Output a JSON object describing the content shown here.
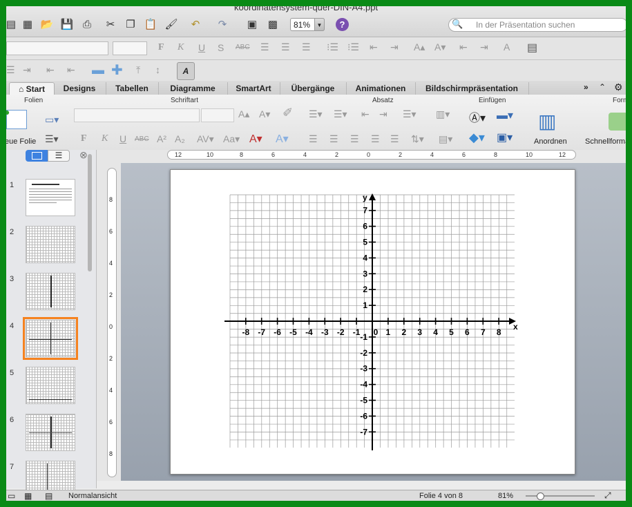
{
  "window": {
    "title": "koordinatensystem-quer-DIN-A4.ppt"
  },
  "toolbar": {
    "zoom": "81%",
    "help_label": "?",
    "search_placeholder": "In der Präsentation suchen",
    "font_size_button": "A",
    "icons": [
      "new-slide-icon",
      "gallery-icon",
      "open-icon",
      "save-icon",
      "print-icon",
      "cut-icon",
      "copy-icon",
      "paste-icon",
      "format-painter-icon",
      "undo-icon",
      "redo-icon",
      "slideshow-icon",
      "media-icon"
    ]
  },
  "format_bar": {
    "bold": "F",
    "italic": "K",
    "underline": "U",
    "shadow": "S",
    "strike": "ABC"
  },
  "tabs": [
    "Start",
    "Designs",
    "Tabellen",
    "Diagramme",
    "SmartArt",
    "Übergänge",
    "Animationen",
    "Bildschirmpräsentation"
  ],
  "ribbon": {
    "groups": [
      "Folien",
      "Schriftart",
      "Absatz",
      "Einfügen",
      "Form"
    ],
    "new_slide_label": "eue Folie",
    "arrange_label": "Anordnen",
    "quick_styles_label": "Schnellforma"
  },
  "slides": [
    {
      "number": "1",
      "kind": "text"
    },
    {
      "number": "2",
      "kind": "grid"
    },
    {
      "number": "3",
      "kind": "grid-axis"
    },
    {
      "number": "4",
      "kind": "grid-axes",
      "selected": true
    },
    {
      "number": "5",
      "kind": "grid-xaxis"
    },
    {
      "number": "6",
      "kind": "grid-quadrant"
    },
    {
      "number": "7",
      "kind": "grid-quadrant"
    }
  ],
  "ruler": {
    "top_labels": [
      "12",
      "10",
      "8",
      "6",
      "4",
      "2",
      "0",
      "2",
      "4",
      "6",
      "8",
      "10",
      "12"
    ],
    "left_labels": [
      "8",
      "6",
      "4",
      "2",
      "0",
      "2",
      "4",
      "6",
      "8"
    ]
  },
  "coordinate_system": {
    "x_label": "x",
    "y_label": "y",
    "x_ticks": [
      "-8",
      "-7",
      "-6",
      "-5",
      "-4",
      "-3",
      "-2",
      "-1",
      "0",
      "1",
      "2",
      "3",
      "4",
      "5",
      "6",
      "7",
      "8"
    ],
    "y_ticks": [
      "7",
      "6",
      "5",
      "4",
      "3",
      "2",
      "1",
      "-1",
      "-2",
      "-3",
      "-4",
      "-5",
      "-6",
      "-7"
    ]
  },
  "status": {
    "view": "Normalansicht",
    "slide_position": "Folie 4 von 8",
    "zoom": "81%"
  }
}
